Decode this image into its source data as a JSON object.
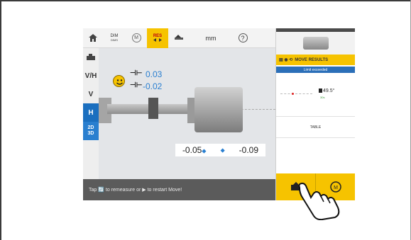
{
  "toolbar": {
    "dim_label": "DIM",
    "dim_sub": "DIMS",
    "m_label": "M",
    "res_label": "RES",
    "unit_label": "mm",
    "help_label": "?"
  },
  "view_modes": [
    {
      "label": "V/H"
    },
    {
      "label": "V"
    },
    {
      "label": "H"
    },
    {
      "label": "2D\n3D"
    }
  ],
  "results": {
    "gap_value": "0.03",
    "offset_value": "-0.02",
    "left_value": "-0.05",
    "right_value": "-0.09",
    "left_arrow": "⬥",
    "right_arrow": "⬥"
  },
  "status_bar": {
    "text": "Tap 🔄 to remeasure or ▶ to restart Move!"
  },
  "right_panel": {
    "move_results_label": "MOVE RESULTS",
    "limit_label": "Limit exceeded",
    "angle_value": "49.5°",
    "angle_sub": "30s",
    "table_label": "TABLE"
  },
  "colors": {
    "accent_yellow": "#f6c300",
    "accent_blue": "#1b6fbf",
    "value_blue": "#2a7fd0",
    "status_gray": "#5b5b5b"
  },
  "icons": {
    "home": "home-icon",
    "dim": "dimensions-icon",
    "measure": "measure-icon",
    "results": "results-icon",
    "move": "move-icon",
    "help": "help-icon",
    "smiley": "smiley-icon",
    "hand": "pointing-hand-icon"
  }
}
